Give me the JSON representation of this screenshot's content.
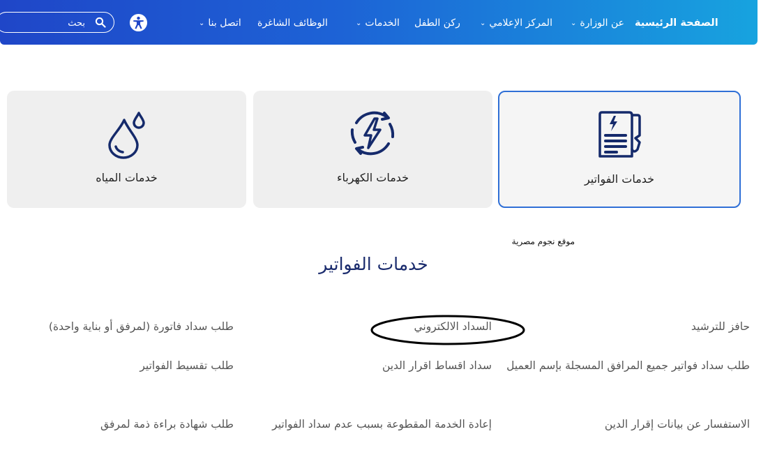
{
  "nav": {
    "home": "الصفحة الرئيسية",
    "about": "عن الوزارة",
    "media": "المركز الإعلامي",
    "kids": "ركن الطفل",
    "services": "الخدمات",
    "jobs": "الوظائف الشاغرة",
    "contact": "اتصل بنا",
    "search_placeholder": "بحث"
  },
  "cards": [
    {
      "label": "خدمات الفواتير",
      "icon": "invoice-document-icon",
      "selected": true
    },
    {
      "label": "خدمات الكهرباء",
      "icon": "electricity-bolt-icon",
      "selected": false
    },
    {
      "label": "خدمات المياه",
      "icon": "water-drops-icon",
      "selected": false
    }
  ],
  "site_note": "موقع نجوم مصرية",
  "section_title": "خدمات الفواتير",
  "services": {
    "r1c1": "حافز للترشيد",
    "r1c2": "السداد الالكتروني",
    "r1c3": "طلب سداد فاتورة (لمرفق أو بناية واحدة)",
    "r2c1": "طلب سداد فواتير جميع المرافق المسجلة بإسم العميل",
    "r2c2": "سداد اقساط اقرار الدين",
    "r2c3": "طلب تقسيط الفواتير",
    "r3c1": "الاستفسار عن بيانات إقرار الدين",
    "r3c2": "إعادة الخدمة المقطوعة بسبب عدم سداد الفواتير",
    "r3c3": "طلب شهادة براءة ذمة لمرفق"
  },
  "colors": {
    "nav_start": "#1f46c8",
    "nav_end": "#17a3df",
    "icon_navy": "#152a6b",
    "selected_border": "#2f6fd6",
    "title": "#1a2b6d"
  }
}
